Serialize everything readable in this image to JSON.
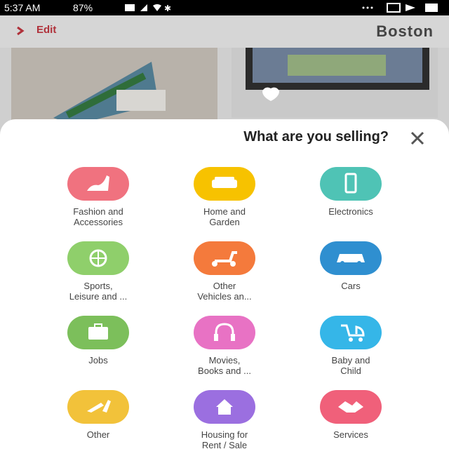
{
  "status_bar": {
    "time": "5:37 AM",
    "battery": "87%"
  },
  "header": {
    "edit_label": "Edit",
    "city": "Boston"
  },
  "sheet": {
    "title": "What are you selling?",
    "categories": [
      {
        "label": "Electronics",
        "icon": "phone-icon",
        "color": "#4fc3b5"
      },
      {
        "label": "Home and\nGarden",
        "icon": "sofa-icon",
        "color": "#f7c200"
      },
      {
        "label": "Fashion and\nAccessories",
        "icon": "high-heel-icon",
        "color": "#f0727f"
      },
      {
        "label": "Cars",
        "icon": "car-icon",
        "color": "#2f8fd0"
      },
      {
        "label": "Other\nVehicles an...",
        "icon": "scooter-icon",
        "color": "#f47a3c"
      },
      {
        "label": "Sports,\nLeisure and ...",
        "icon": "basketball-icon",
        "color": "#8fcf6b"
      },
      {
        "label": "Baby and\nChild",
        "icon": "stroller-icon",
        "color": "#35b6e8"
      },
      {
        "label": "Movies,\nBooks and ...",
        "icon": "headphones-icon",
        "color": "#e872c4"
      },
      {
        "label": "Jobs",
        "icon": "briefcase-icon",
        "color": "#7cbf5b"
      },
      {
        "label": "Services",
        "icon": "handshake-icon",
        "color": "#f0607a"
      },
      {
        "label": "Housing for\nRent / Sale",
        "icon": "house-icon",
        "color": "#9b6fe0"
      },
      {
        "label": "Other",
        "icon": "multitool-icon",
        "color": "#f2c23a"
      }
    ]
  }
}
